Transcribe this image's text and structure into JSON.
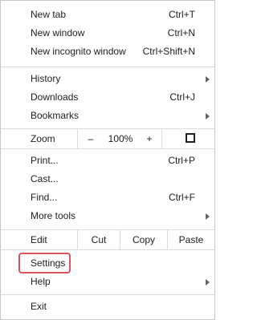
{
  "menu": {
    "new_tab": {
      "label": "New tab",
      "shortcut": "Ctrl+T"
    },
    "new_window": {
      "label": "New window",
      "shortcut": "Ctrl+N"
    },
    "new_incognito": {
      "label": "New incognito window",
      "shortcut": "Ctrl+Shift+N"
    },
    "history": {
      "label": "History"
    },
    "downloads": {
      "label": "Downloads",
      "shortcut": "Ctrl+J"
    },
    "bookmarks": {
      "label": "Bookmarks"
    },
    "zoom": {
      "label": "Zoom",
      "minus": "–",
      "level": "100%",
      "plus": "+",
      "fullscreen_icon": "fullscreen-icon"
    },
    "print": {
      "label": "Print...",
      "shortcut": "Ctrl+P"
    },
    "cast": {
      "label": "Cast..."
    },
    "find": {
      "label": "Find...",
      "shortcut": "Ctrl+F"
    },
    "more_tools": {
      "label": "More tools"
    },
    "edit": {
      "label": "Edit",
      "cut": "Cut",
      "copy": "Copy",
      "paste": "Paste"
    },
    "settings": {
      "label": "Settings",
      "highlight_color": "#e0525a"
    },
    "help": {
      "label": "Help"
    },
    "exit": {
      "label": "Exit"
    }
  }
}
